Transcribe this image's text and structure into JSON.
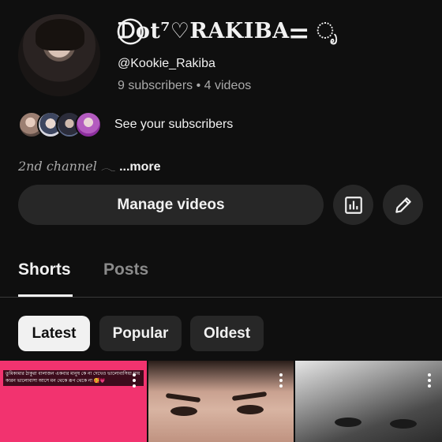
{
  "channel": {
    "name": "ᗪ⃝ot⁷♡RAKIBA⚌ ೃ",
    "handle": "@Kookie_Rakiba",
    "stats": "9 subscribers • 4 videos",
    "see_subscribers": "See your subscribers",
    "description": "2nd channel 𓂃",
    "more": "...more"
  },
  "actions": {
    "manage_videos": "Manage videos",
    "analytics_icon": "bar-chart-icon",
    "edit_icon": "pencil-icon"
  },
  "tabs": [
    {
      "label": "Shorts",
      "active": true
    },
    {
      "label": "Posts",
      "active": false
    }
  ],
  "filters": [
    {
      "label": "Latest",
      "active": true
    },
    {
      "label": "Popular",
      "active": false
    },
    {
      "label": "Oldest",
      "active": false
    }
  ],
  "shorts": [
    {
      "caption": "তুমিকামার ঠাকুরা বালাজন একবার মানুষ কে না দেখেও ভালোবাসিয়া যায় কারন ভালোবাসা আসে মন থেকে রূপ থেকে না 🥰💗"
    },
    {
      "caption": ""
    },
    {
      "caption": ""
    }
  ],
  "colors": {
    "background": "#0f0f0f",
    "button": "#272727",
    "text_primary": "#f1f1f1",
    "text_secondary": "#aaaaaa",
    "short_1_bg": "#f2336f"
  }
}
